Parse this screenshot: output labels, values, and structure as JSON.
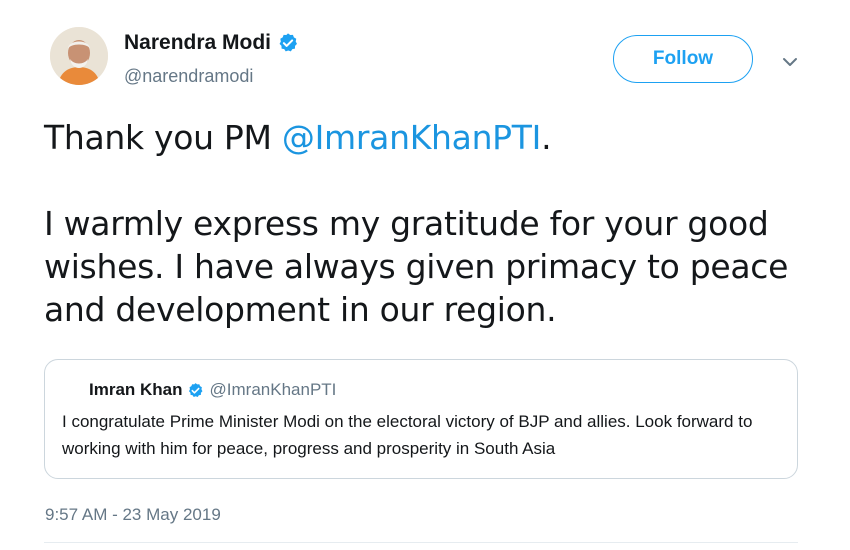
{
  "author": {
    "name": "Narendra Modi",
    "handle": "@narendramodi",
    "verified_icon": "verified-badge-icon",
    "avatar_icon": "user-avatar"
  },
  "follow_label": "Follow",
  "caret_icon": "chevron-down-icon",
  "tweet": {
    "line1_prefix": "Thank you PM ",
    "line1_mention": "@ImranKhanPTI",
    "line1_suffix": ".",
    "paragraph2": "I warmly express my gratitude for your good wishes. I have always given primacy to peace and development in our region."
  },
  "quoted": {
    "name": "Imran Khan",
    "handle": "@ImranKhanPTI",
    "text": "I congratulate Prime Minister Modi on the electoral victory of BJP and allies. Look forward to working with him for peace, progress and prosperity in South Asia"
  },
  "timestamp": "9:57 AM - 23 May 2019",
  "colors": {
    "accent": "#1da1f2",
    "mention": "#1b95e0",
    "secondary_text": "#657786",
    "border": "#ccd6dd"
  }
}
